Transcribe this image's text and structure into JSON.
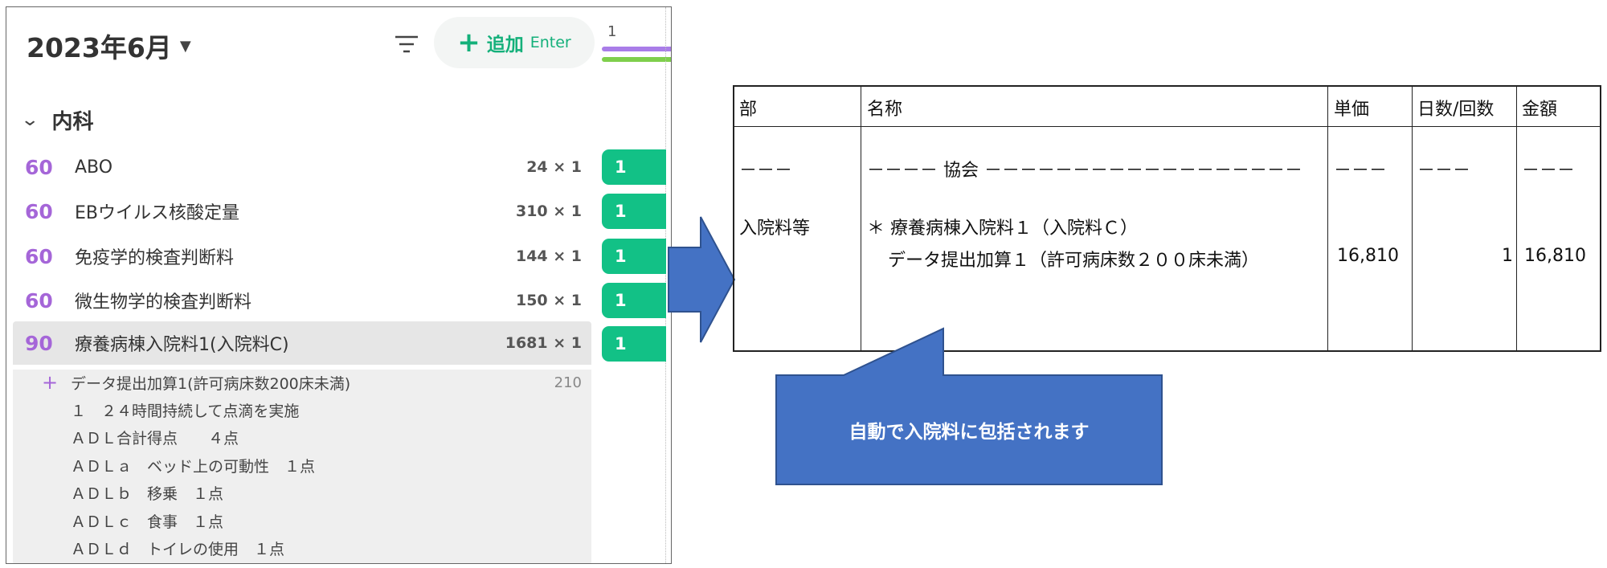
{
  "header": {
    "month": "2023年6月",
    "add_label": "追加",
    "add_hint": "Enter",
    "timeline_num": "1"
  },
  "section": {
    "title": "内科"
  },
  "rows": [
    {
      "points": "60",
      "name": "ABO",
      "qty": "24 × 1",
      "badge": "1"
    },
    {
      "points": "60",
      "name": "EBウイルス核酸定量",
      "qty": "310 × 1",
      "badge": "1"
    },
    {
      "points": "60",
      "name": "免疫学的検査判断料",
      "qty": "144 × 1",
      "badge": "1"
    },
    {
      "points": "60",
      "name": "微生物学的検査判断料",
      "qty": "150 × 1",
      "badge": "1"
    },
    {
      "points": "90",
      "name": "療養病棟入院料1(入院料C)",
      "qty": "1681 × 1",
      "badge": "1"
    }
  ],
  "sub_items": [
    {
      "plus": "+",
      "text": "データ提出加算1(許可病床数200床未満)",
      "points": "210"
    },
    {
      "text": "１　２４時間持続して点滴を実施"
    },
    {
      "text": "ＡＤＬ合計得点　　４点"
    },
    {
      "text": "ＡＤＬａ　ベッド上の可動性　１点"
    },
    {
      "text": "ＡＤＬｂ　移乗　１点"
    },
    {
      "text": "ＡＤＬｃ　食事　１点"
    },
    {
      "text": "ＡＤＬｄ　トイレの使用　１点"
    }
  ],
  "claim": {
    "headers": [
      "部",
      "名称",
      "単価",
      "日数/回数",
      "金額"
    ],
    "dash_row": {
      "bu": "－－－",
      "name": "－－－－ 協会 －－－－－－－－－－－－－－－－－－",
      "tanka": "－－－",
      "days": "－－－",
      "kingaku": "－－－"
    },
    "bu": "入院料等",
    "line1": "＊ 療養病棟入院料１（入院料Ｃ）",
    "line2": "データ提出加算１（許可病床数２００床未満）",
    "tanka": "16,810",
    "days": "1",
    "kingaku": "16,810"
  },
  "callout": {
    "text": "自動で入院料に包括されます"
  },
  "colors": {
    "accent_green": "#14b07a",
    "badge_green": "#12c186",
    "points_purple": "#a566d8",
    "callout_blue": "#4472c4",
    "callout_border": "#2f528f"
  }
}
